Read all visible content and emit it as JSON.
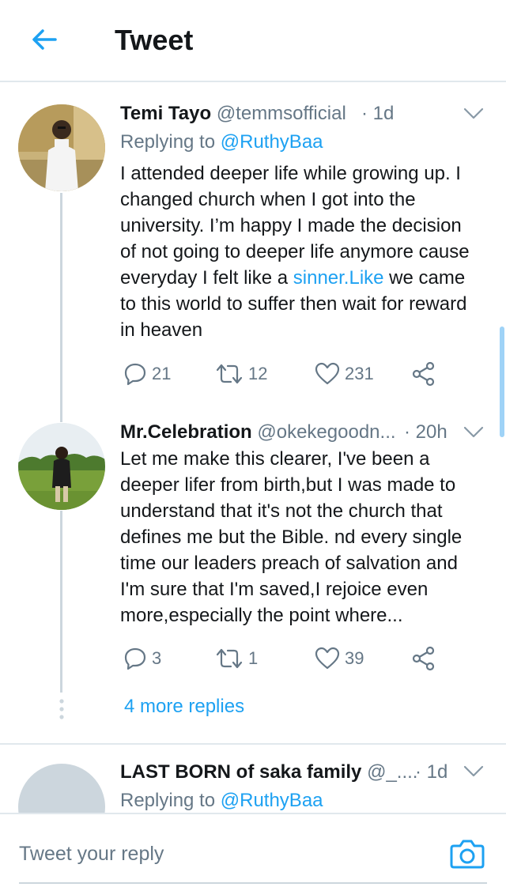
{
  "header": {
    "title": "Tweet",
    "back_icon": "arrow-left-icon"
  },
  "colors": {
    "accent": "#1da1f2",
    "muted": "#657786",
    "text": "#14171a",
    "border": "#e1e8ed"
  },
  "tweets": [
    {
      "name": "Temi Tayo",
      "handle": "@temmsofficial",
      "time": "· 1d",
      "replying_prefix": "Replying to",
      "replying_handle": "@RuthyBaa",
      "text_lines": [
        "I attended deeper life while growing up. I",
        "changed church when I got into the",
        "university. I’m happy I made the decision",
        "of not going to deeper life anymore cause"
      ],
      "text_line5_before": "everyday I felt like a ",
      "text_line5_link": "sinner.Like",
      "text_line5_after": " we came",
      "text_lines_end": [
        "to this world to suffer then wait for reward",
        "in heaven"
      ],
      "replies": "21",
      "retweets": "12",
      "likes": "231"
    },
    {
      "name": "Mr.Celebration",
      "handle": "@okekegoodn...",
      "time": "· 20h",
      "text_lines": [
        "Let me make this clearer, I've been a",
        "deeper lifer from birth,but I was made to",
        "understand that it's not the church that",
        "defines me but the Bible. nd every single",
        "time our leaders preach of salvation and",
        "I'm sure that I'm saved,I rejoice even",
        "more,especially the point where..."
      ],
      "replies": "3",
      "retweets": "1",
      "likes": "39"
    },
    {
      "name": "LAST BORN of saka family",
      "handle": "@_....",
      "time": "· 1d",
      "replying_prefix": "Replying to",
      "replying_handle": "@RuthyBaa"
    }
  ],
  "more_replies": "4 more replies",
  "reply_bar": {
    "placeholder": "Tweet your reply",
    "camera_icon": "camera-icon"
  }
}
